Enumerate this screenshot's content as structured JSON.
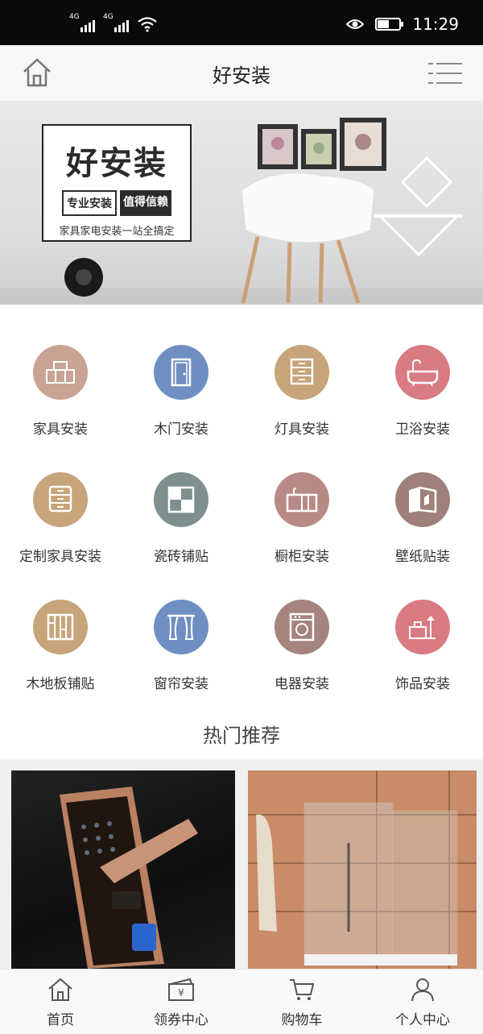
{
  "status_bar": {
    "signal1": "4G",
    "signal2": "4G",
    "time": "11:29",
    "battery_level": 0.5
  },
  "header": {
    "title": "好安装",
    "home_icon": "home-icon",
    "menu_icon": "list-menu-icon"
  },
  "banner": {
    "headline": "好安装",
    "tag1": "专业安装",
    "tag2": "值得信赖",
    "subline": "家具家电安装一站全搞定"
  },
  "categories": [
    {
      "label": "家具安装",
      "icon": "furniture-icon",
      "color": "#c9a394"
    },
    {
      "label": "木门安装",
      "icon": "door-icon",
      "color": "#6f8fc2"
    },
    {
      "label": "灯具安装",
      "icon": "cabinet-drawers-icon",
      "color": "#c7a47a"
    },
    {
      "label": "卫浴安装",
      "icon": "bathtub-icon",
      "color": "#d97b82"
    },
    {
      "label": "定制家具安装",
      "icon": "custom-furniture-icon",
      "color": "#c7a47a"
    },
    {
      "label": "瓷砖铺贴",
      "icon": "tile-icon",
      "color": "#7d8f8f"
    },
    {
      "label": "橱柜安装",
      "icon": "kitchen-cabinet-icon",
      "color": "#b88a86"
    },
    {
      "label": "壁纸贴装",
      "icon": "wallpaper-icon",
      "color": "#9f807a"
    },
    {
      "label": "木地板铺贴",
      "icon": "wood-floor-icon",
      "color": "#c7a47a"
    },
    {
      "label": "窗帘安装",
      "icon": "curtain-icon",
      "color": "#6f8fc2"
    },
    {
      "label": "电器安装",
      "icon": "washing-machine-icon",
      "color": "#a6837d"
    },
    {
      "label": "饰品安装",
      "icon": "decor-icon",
      "color": "#d97b82"
    }
  ],
  "section": {
    "title": "热门推荐"
  },
  "products": [
    {
      "name": "smart-door-lock-image"
    },
    {
      "name": "shower-enclosure-image"
    }
  ],
  "tabbar": {
    "items": [
      {
        "label": "首页",
        "icon": "home-icon"
      },
      {
        "label": "领券中心",
        "icon": "coupon-icon"
      },
      {
        "label": "购物车",
        "icon": "cart-icon"
      },
      {
        "label": "个人中心",
        "icon": "user-icon"
      }
    ]
  }
}
